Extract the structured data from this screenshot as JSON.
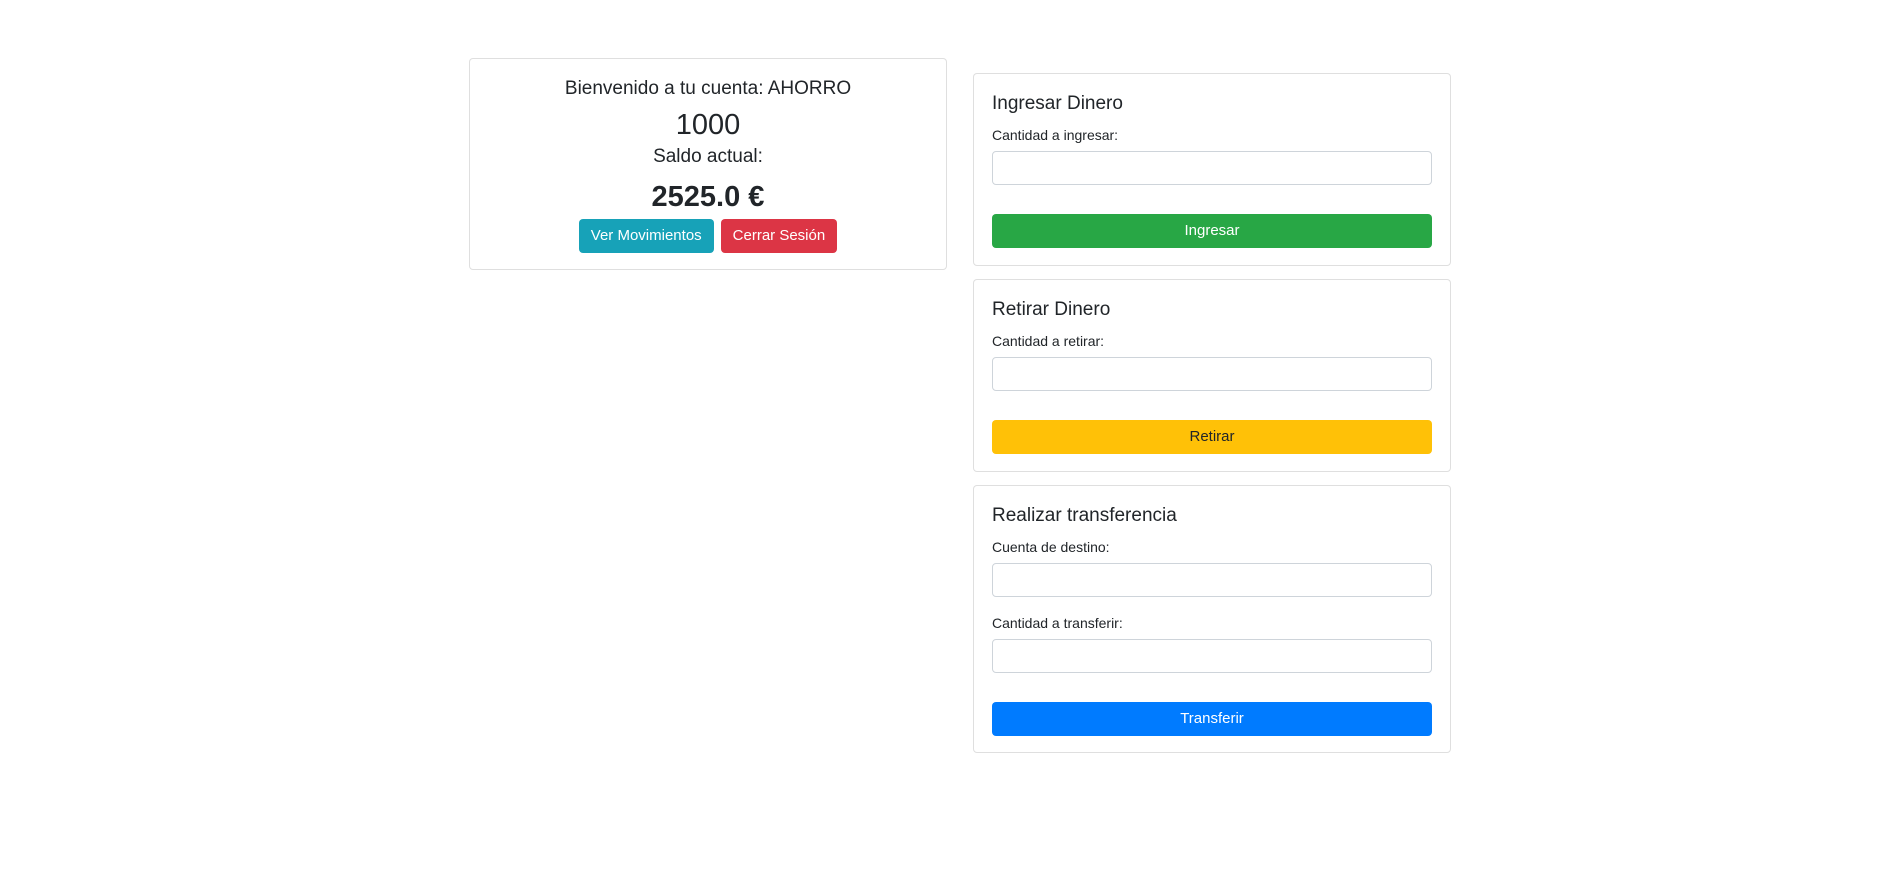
{
  "account": {
    "welcome_text": "Bienvenido a tu cuenta: AHORRO",
    "account_number": "1000",
    "balance_label": "Saldo actual:",
    "balance_value": "2525.0 €",
    "movements_button": "Ver Movimientos",
    "logout_button": "Cerrar Sesión"
  },
  "deposit": {
    "title": "Ingresar Dinero",
    "amount_label": "Cantidad a ingresar:",
    "amount_value": "",
    "submit_button": "Ingresar"
  },
  "withdraw": {
    "title": "Retirar Dinero",
    "amount_label": "Cantidad a retirar:",
    "amount_value": "",
    "submit_button": "Retirar"
  },
  "transfer": {
    "title": "Realizar transferencia",
    "destination_label": "Cuenta de destino:",
    "destination_value": "",
    "amount_label": "Cantidad a transferir:",
    "amount_value": "",
    "submit_button": "Transferir"
  },
  "colors": {
    "info": "#17a2b8",
    "danger": "#dc3545",
    "success": "#28a745",
    "warning": "#ffc107",
    "primary": "#007bff"
  }
}
